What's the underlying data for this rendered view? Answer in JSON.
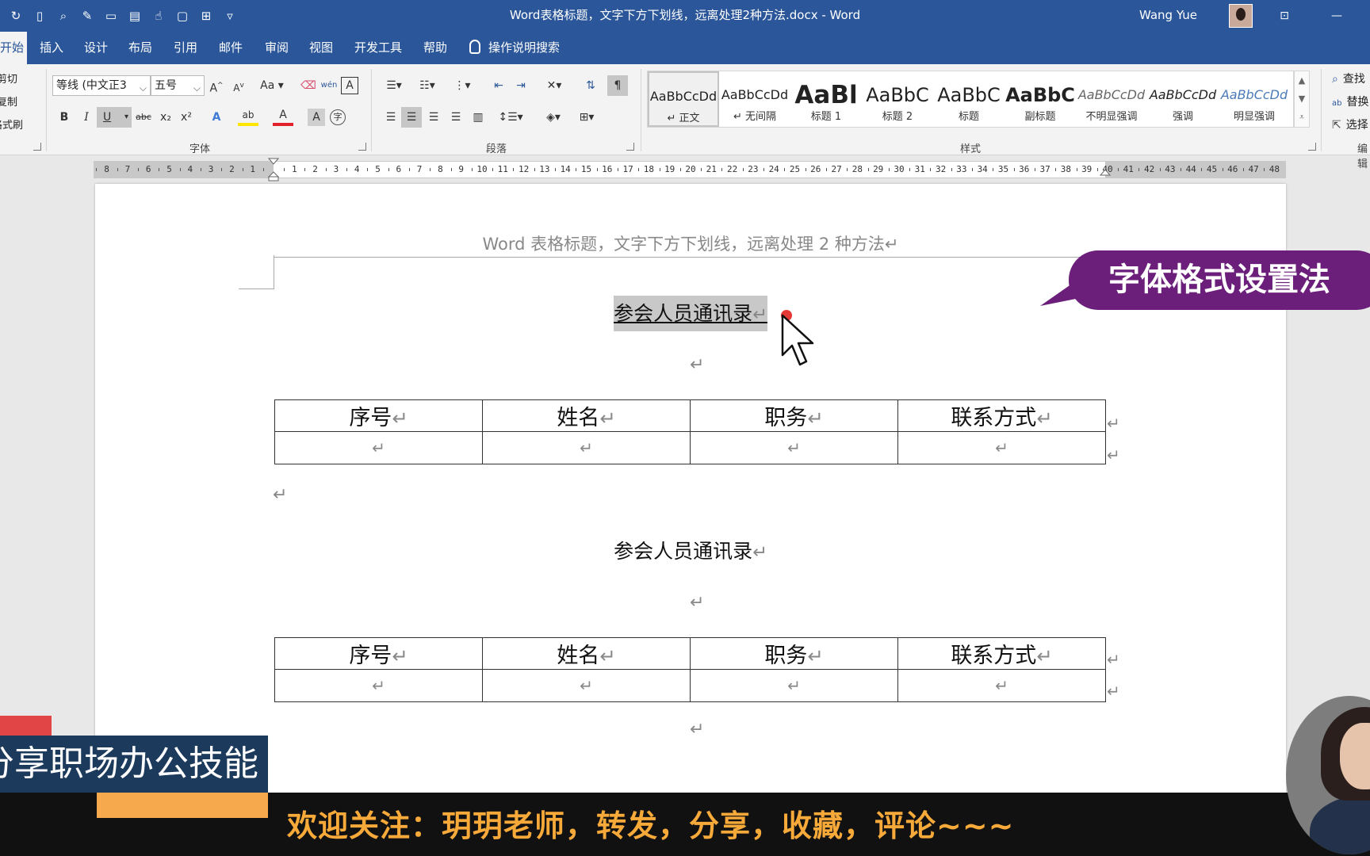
{
  "titlebar": {
    "doc_title": "Word表格标题，文字下方下划线，远离处理2种方法.docx  -  Word",
    "user_name": "Wang Yue",
    "qat_icons": [
      "autosave-icon",
      "new-doc-icon",
      "print-preview-icon",
      "format-painter-icon",
      "open-icon",
      "page-icon",
      "touch-mode-icon",
      "comment-icon",
      "layout-icon",
      "customize-qat-icon"
    ]
  },
  "tabs": [
    "开始",
    "插入",
    "设计",
    "布局",
    "引用",
    "邮件",
    "审阅",
    "视图",
    "开发工具",
    "帮助"
  ],
  "tell_me": "操作说明搜索",
  "ribbon": {
    "clipboard": [
      "剪切",
      "复制",
      "格式刷"
    ],
    "font": {
      "label": "字体",
      "name": "等线 (中文正3",
      "size": "五号",
      "buttons": [
        "B",
        "I",
        "U",
        "abc",
        "x₂",
        "x²"
      ],
      "grow": "A",
      "shrink": "A",
      "case": "Aa",
      "pinyin": "wén",
      "border_char": "A",
      "text_effect": "A",
      "highlight": "ab",
      "font_color": "A",
      "shade_char": "A",
      "enclose": "字"
    },
    "paragraph": {
      "label": "段落"
    },
    "styles": {
      "label": "样式",
      "items": [
        {
          "preview": "AaBbCcDd",
          "name": "↵ 正文"
        },
        {
          "preview": "AaBbCcDd",
          "name": "↵ 无间隔"
        },
        {
          "preview": "AaBl",
          "name": "标题 1"
        },
        {
          "preview": "AaBbC",
          "name": "标题 2"
        },
        {
          "preview": "AaBbC",
          "name": "标题"
        },
        {
          "preview": "AaBbC",
          "name": "副标题"
        },
        {
          "preview": "AaBbCcDd",
          "name": "不明显强调"
        },
        {
          "preview": "AaBbCcDd",
          "name": "强调"
        },
        {
          "preview": "AaBbCcDd",
          "name": "明显强调"
        }
      ]
    },
    "editing": {
      "label": "编辑",
      "find": "查找",
      "replace": "替换",
      "select": "选择"
    }
  },
  "ruler": {
    "left_numbers": [
      "8",
      "7",
      "6",
      "5",
      "4",
      "3",
      "2",
      "1"
    ],
    "right_numbers": [
      "1",
      "2",
      "3",
      "4",
      "5",
      "6",
      "7",
      "8",
      "9",
      "10",
      "11",
      "12",
      "13",
      "14",
      "15",
      "16",
      "17",
      "18",
      "19",
      "20",
      "21",
      "22",
      "23",
      "24",
      "25",
      "26",
      "27",
      "28",
      "29",
      "30",
      "31",
      "32",
      "33",
      "34",
      "35",
      "36",
      "37",
      "38",
      "39",
      "40",
      "41",
      "42",
      "43",
      "44",
      "45",
      "46",
      "47",
      "48"
    ]
  },
  "document": {
    "header": "Word 表格标题，文字下方下划线，远离处理 2 种方法↵",
    "heading1": "参会人员通讯录",
    "heading2": "参会人员通讯录",
    "return_mark": "↵",
    "table1": {
      "headers": [
        "序号",
        "姓名",
        "职务",
        "联系方式"
      ]
    },
    "table2": {
      "headers": [
        "序号",
        "姓名",
        "职务",
        "联系方式"
      ]
    }
  },
  "overlay": {
    "callout": "字体格式设置法",
    "banner": "分享职场办公技能",
    "bottom_bar": "欢迎关注：玥玥老师，转发，分享，收藏，评论~~~"
  },
  "colors": {
    "word_blue": "#2b579a",
    "callout_purple": "#6b1f7a",
    "bottom_orange": "#f7a93a",
    "banner_blue": "#1c3a5c"
  }
}
